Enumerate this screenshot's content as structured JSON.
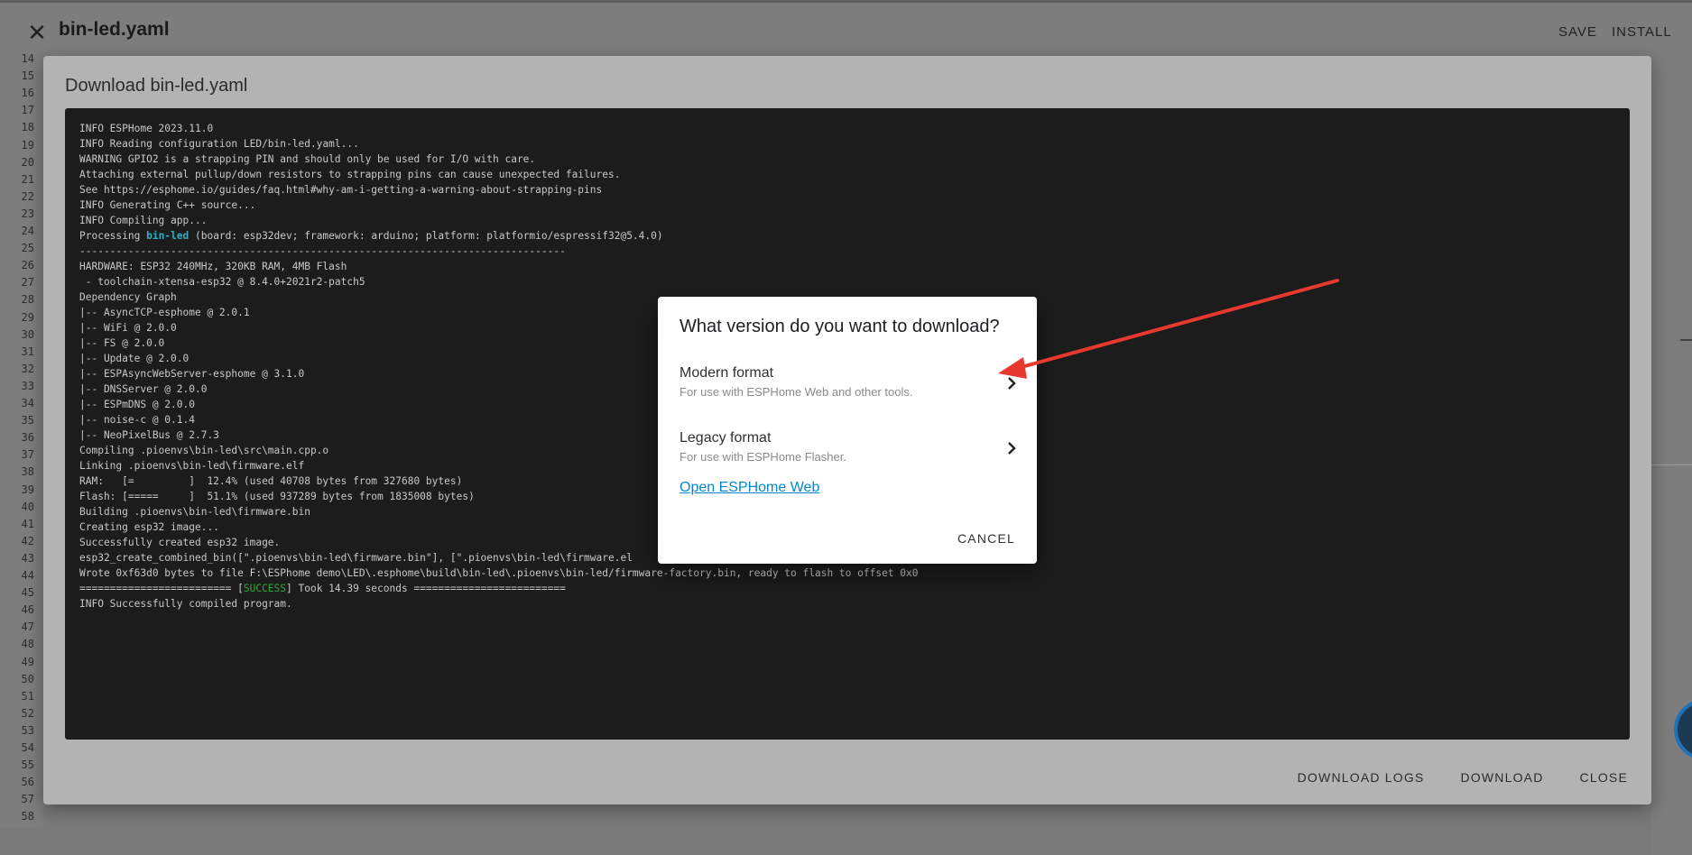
{
  "editor": {
    "file_title": "bin-led.yaml",
    "save_label": "SAVE",
    "install_label": "INSTALL",
    "line_numbers": [
      "14",
      "15",
      "16",
      "17",
      "18",
      "19",
      "20",
      "21",
      "22",
      "23",
      "24",
      "25",
      "26",
      "27",
      "28",
      "29",
      "30",
      "31",
      "32",
      "33",
      "34",
      "35",
      "36",
      "37",
      "38",
      "39",
      "40",
      "41",
      "42",
      "43",
      "44",
      "45",
      "46",
      "47",
      "48",
      "49",
      "50",
      "51",
      "52",
      "53",
      "54",
      "55",
      "56",
      "57",
      "58"
    ]
  },
  "download_dialog": {
    "title": "Download bin-led.yaml",
    "logs": [
      "INFO ESPHome 2023.11.0",
      "INFO Reading configuration LED/bin-led.yaml...",
      "WARNING GPIO2 is a strapping PIN and should only be used for I/O with care.",
      "Attaching external pullup/down resistors to strapping pins can cause unexpected failures.",
      "See https://esphome.io/guides/faq.html#why-am-i-getting-a-warning-about-strapping-pins",
      "INFO Generating C++ source...",
      "INFO Compiling app...",
      "Processing ",
      "--------------------------------------------------------------------------------",
      "HARDWARE: ESP32 240MHz, 320KB RAM, 4MB Flash",
      " - toolchain-xtensa-esp32 @ 8.4.0+2021r2-patch5",
      "Dependency Graph",
      "|-- AsyncTCP-esphome @ 2.0.1",
      "|-- WiFi @ 2.0.0",
      "|-- FS @ 2.0.0",
      "|-- Update @ 2.0.0",
      "|-- ESPAsyncWebServer-esphome @ 3.1.0",
      "|-- DNSServer @ 2.0.0",
      "|-- ESPmDNS @ 2.0.0",
      "|-- noise-c @ 0.1.4",
      "|-- NeoPixelBus @ 2.7.3",
      "Compiling .pioenvs\\bin-led\\src\\main.cpp.o",
      "Linking .pioenvs\\bin-led\\firmware.elf",
      "RAM:   [=         ]  12.4% (used 40708 bytes from 327680 bytes)",
      "Flash: [=====     ]  51.1% (used 937289 bytes from 1835008 bytes)",
      "Building .pioenvs\\bin-led\\firmware.bin",
      "Creating esp32 image...",
      "Successfully created esp32 image.",
      "esp32_create_combined_bin([\".pioenvs\\bin-led\\firmware.bin\"], [\".pioenvs\\bin-led\\firmware.el",
      "Wrote 0xf63d0 bytes to file F:\\ESPhome demo\\LED\\.esphome\\build\\bin-led\\.pioenvs\\bin-led/firmware-factory.bin, ready to flash to offset 0x0",
      "========================= [",
      "INFO Successfully compiled program."
    ],
    "processing_name": "bin-led",
    "processing_rest": " (board: esp32dev; framework: arduino; platform: platformio/espressif32@5.4.0)",
    "success_word": "SUCCESS",
    "success_rest": "] Took 14.39 seconds =========================",
    "download_logs_label": "DOWNLOAD LOGS",
    "download_label": "DOWNLOAD",
    "close_label": "CLOSE"
  },
  "version_dialog": {
    "title": "What version do you want to download?",
    "options": [
      {
        "title": "Modern format",
        "subtitle": "For use with ESPHome Web and other tools."
      },
      {
        "title": "Legacy format",
        "subtitle": "For use with ESPHome Flasher."
      }
    ],
    "link_label": "Open ESPHome Web",
    "cancel_label": "CANCEL"
  },
  "colors": {
    "annotation_arrow": "#e8392f",
    "link": "#0288d1",
    "terminal_bg": "#1c1c1c"
  }
}
